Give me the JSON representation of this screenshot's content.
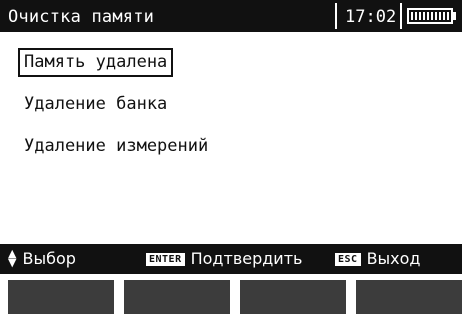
{
  "header": {
    "title": "Очистка памяти",
    "time": "17:02",
    "battery_icon": "battery-full-icon",
    "battery_level": 1.0
  },
  "menu": {
    "items": [
      {
        "label": "Память удалена",
        "selected": true
      },
      {
        "label": "Удаление банка",
        "selected": false
      },
      {
        "label": "Удаление измерений",
        "selected": false
      }
    ]
  },
  "help_bar": {
    "select_icon": "up-down-arrows-icon",
    "select_label": "Выбор",
    "enter_key": "ENTER",
    "enter_label": "Подтвердить",
    "esc_key": "ESC",
    "esc_label": "Выход"
  },
  "softkeys": {
    "count": 4
  },
  "colors": {
    "bar_background": "#111111",
    "softkey": "#3c3c3c",
    "screen_background": "#ffffff"
  }
}
